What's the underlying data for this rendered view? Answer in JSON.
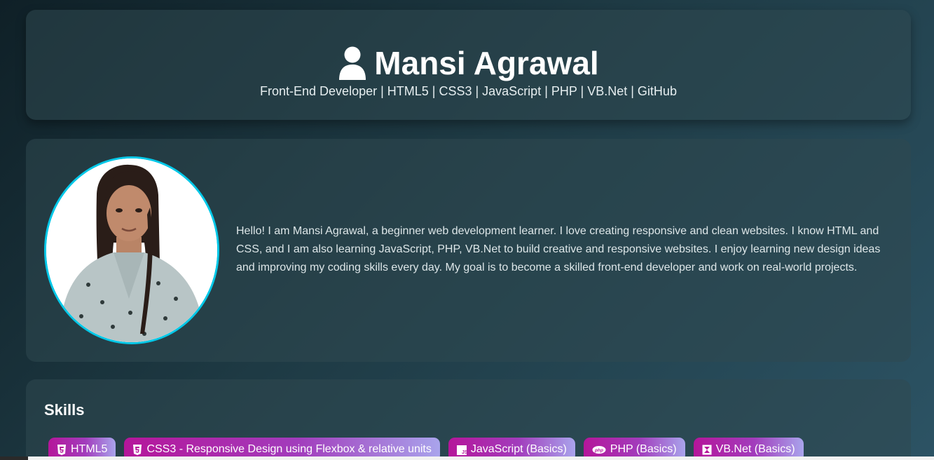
{
  "header": {
    "icon": "user-icon",
    "name": "Mansi Agrawal",
    "tagline": "Front-End Developer | HTML5 | CSS3 | JavaScript | PHP | VB.Net | GitHub"
  },
  "about": {
    "photo": "profile-photo",
    "text": "Hello! I am Mansi Agrawal, a beginner web development learner. I love creating responsive and clean websites. I know HTML and CSS, and I am also learning JavaScript, PHP, VB.Net to build creative and responsive websites. I enjoy learning new design ideas and improving my coding skills every day. My goal is to become a skilled front-end developer and work on real-world projects."
  },
  "skills": {
    "title": "Skills",
    "items": [
      {
        "icon": "html5-icon",
        "label": "HTML5"
      },
      {
        "icon": "css3-icon",
        "label": "CSS3 - Responsive Design using Flexbox & relative units"
      },
      {
        "icon": "javascript-icon",
        "label": "JavaScript (Basics)"
      },
      {
        "icon": "php-icon",
        "label": "PHP (Basics)"
      },
      {
        "icon": "vbnet-icon",
        "label": "VB.Net (Basics)"
      }
    ]
  },
  "colors": {
    "accent_border": "#00c8e8",
    "chip_start": "#b5169a",
    "chip_end": "#a9a4ec"
  }
}
